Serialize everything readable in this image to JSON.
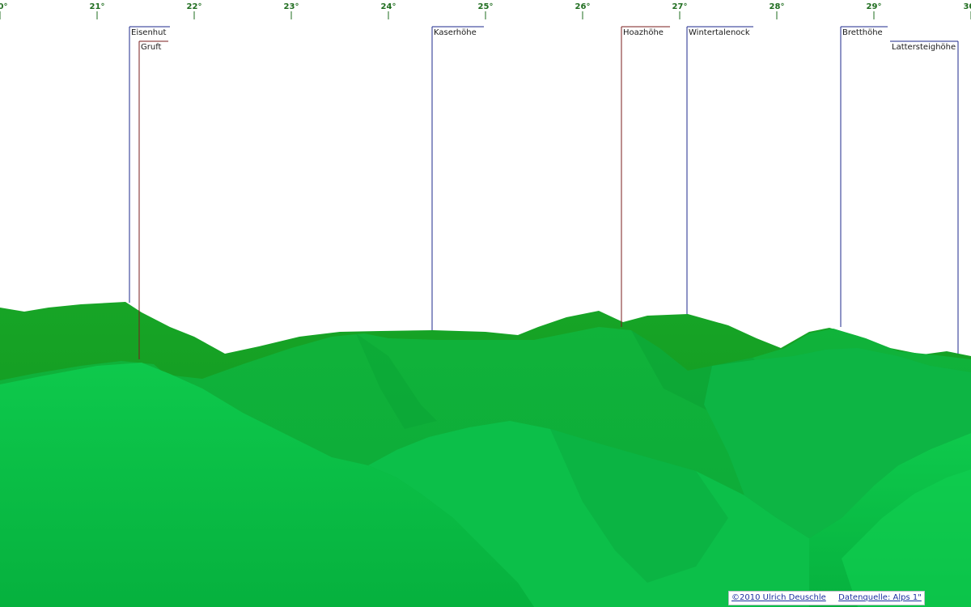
{
  "axis": {
    "ticks": [
      {
        "degree": 20,
        "label": "20°"
      },
      {
        "degree": 21,
        "label": "21°"
      },
      {
        "degree": 22,
        "label": "22°"
      },
      {
        "degree": 23,
        "label": "23°"
      },
      {
        "degree": 24,
        "label": "24°"
      },
      {
        "degree": 25,
        "label": "25°"
      },
      {
        "degree": 26,
        "label": "26°"
      },
      {
        "degree": 27,
        "label": "27°"
      },
      {
        "degree": 28,
        "label": "28°"
      },
      {
        "degree": 29,
        "label": "29°"
      },
      {
        "degree": 30,
        "label": "30°"
      }
    ]
  },
  "peaks": [
    {
      "name": "Eisenhut",
      "line_color": "#1c2a8c"
    },
    {
      "name": "Gruft",
      "line_color": "#7a1c1c"
    },
    {
      "name": "Kaserhöhe",
      "line_color": "#1c2a8c"
    },
    {
      "name": "Hoazhöhe",
      "line_color": "#7a1c1c"
    },
    {
      "name": "Wintertalenock",
      "line_color": "#1c2a8c"
    },
    {
      "name": "Bretthöhe",
      "line_color": "#1c2a8c"
    },
    {
      "name": "Lattersteighöhe",
      "line_color": "#1c2a8c"
    }
  ],
  "credits": {
    "copyright": "©2010 Ulrich Deuschle",
    "source": "Datenquelle: Alps 1\""
  },
  "colors": {
    "sky": "#ffffff",
    "far_ridge": "#129a20",
    "near_hills": "#0bc54a",
    "axis": "#1f6d1f"
  }
}
